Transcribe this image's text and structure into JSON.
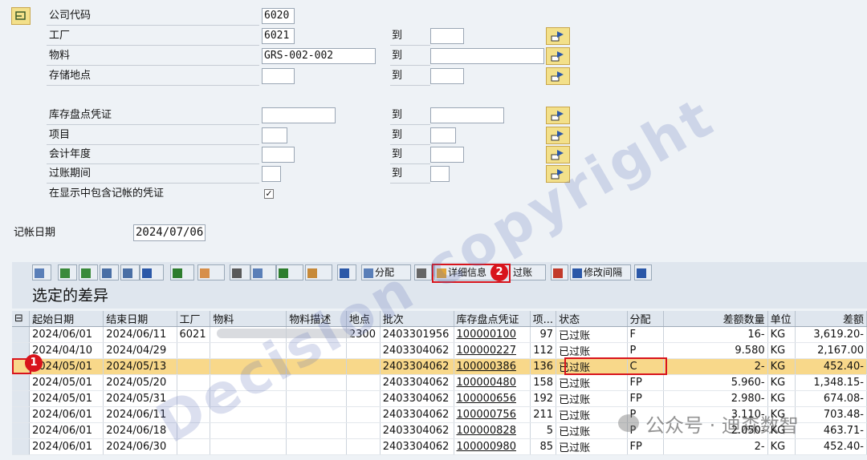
{
  "selection": {
    "fields": [
      {
        "label": "公司代码",
        "value": "6020"
      },
      {
        "label": "工厂",
        "value": "6021"
      },
      {
        "label": "物料",
        "value": "GRS-002-002"
      },
      {
        "label": "存储地点",
        "value": ""
      },
      {
        "label": "库存盘点凭证",
        "value": ""
      },
      {
        "label": "项目",
        "value": ""
      },
      {
        "label": "会计年度",
        "value": ""
      },
      {
        "label": "过账期间",
        "value": ""
      }
    ],
    "to_label": "到",
    "include_posted_label": "在显示中包含记帐的凭证",
    "include_posted_check": "✓",
    "posting_date_label": "记帐日期",
    "posting_date_value": "2024/07/06"
  },
  "toolbar": {
    "distribute_label": "分配",
    "detail_label": "详细信息",
    "post_label": "过账",
    "change_interval_label": "修改间隔"
  },
  "section_title": "选定的差异",
  "table": {
    "columns": [
      "起始日期",
      "结束日期",
      "工厂",
      "物料",
      "物料描述",
      "地点",
      "批次",
      "库存盘点凭证",
      "项...",
      "状态",
      "分配",
      "差额数量",
      "单位",
      "差额"
    ],
    "rows": [
      [
        "2024/06/01",
        "2024/06/11",
        "6021",
        "",
        "",
        "2300",
        "2403301956",
        "100000100",
        "97",
        "已过账",
        "F",
        "16-",
        "KG",
        "3,619.20-"
      ],
      [
        "2024/04/10",
        "2024/04/29",
        "",
        "",
        "",
        "",
        "2403304062",
        "100000227",
        "112",
        "已过账",
        "P",
        "9.580",
        "KG",
        "2,167.00"
      ],
      [
        "2024/05/01",
        "2024/05/13",
        "",
        "",
        "",
        "",
        "2403304062",
        "100000386",
        "136",
        "已过账",
        "C",
        "2-",
        "KG",
        "452.40-"
      ],
      [
        "2024/05/01",
        "2024/05/20",
        "",
        "",
        "",
        "",
        "2403304062",
        "100000480",
        "158",
        "已过账",
        "FP",
        "5.960-",
        "KG",
        "1,348.15-"
      ],
      [
        "2024/05/01",
        "2024/05/31",
        "",
        "",
        "",
        "",
        "2403304062",
        "100000656",
        "192",
        "已过账",
        "FP",
        "2.980-",
        "KG",
        "674.08-"
      ],
      [
        "2024/06/01",
        "2024/06/11",
        "",
        "",
        "",
        "",
        "2403304062",
        "100000756",
        "211",
        "已过账",
        "P",
        "3.110-",
        "KG",
        "703.48-"
      ],
      [
        "2024/06/01",
        "2024/06/18",
        "",
        "",
        "",
        "",
        "2403304062",
        "100000828",
        "5",
        "已过账",
        "P",
        "2.050-",
        "KG",
        "463.71-"
      ],
      [
        "2024/06/01",
        "2024/06/30",
        "",
        "",
        "",
        "",
        "2403304062",
        "100000980",
        "85",
        "已过账",
        "FP",
        "2-",
        "KG",
        "452.40-"
      ]
    ],
    "highlighted_row": 2
  },
  "annotations": {
    "badge1": "1",
    "badge2": "2"
  },
  "watermark": {
    "text": "Decision copyright",
    "account": "公众号 · 迪森数智"
  },
  "colors": {
    "highlight": "#f8d88a",
    "annotation_red": "#d8141c",
    "background": "#eef2f6"
  }
}
